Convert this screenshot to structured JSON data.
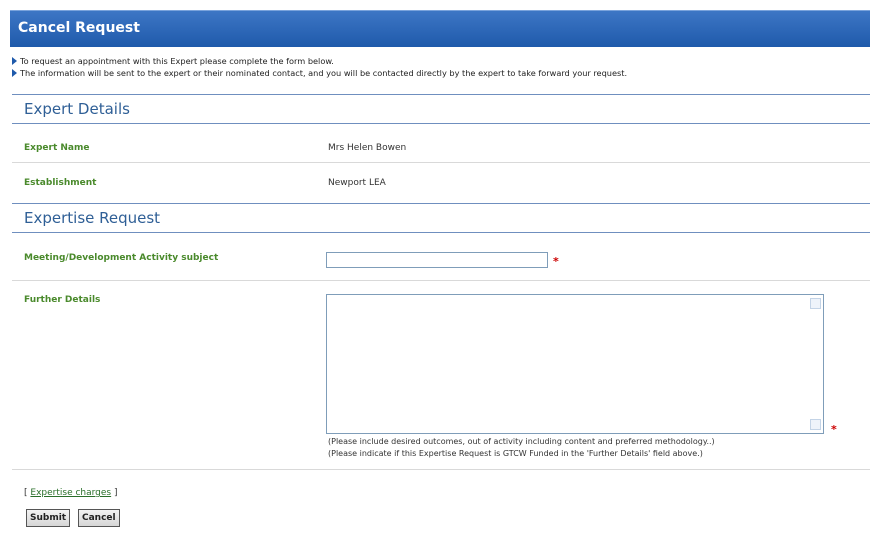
{
  "header": {
    "title": "Cancel Request"
  },
  "intro": {
    "lines": [
      "To request an appointment with this Expert please complete the form below.",
      "The information will be sent to the expert or their nominated contact, and you will be contacted directly by the expert to take forward your request."
    ]
  },
  "expert_details": {
    "heading": "Expert Details",
    "rows": [
      {
        "label": "Expert Name",
        "value": "Mrs Helen Bowen"
      },
      {
        "label": "Establishment",
        "value": "Newport LEA"
      }
    ]
  },
  "expertise_request": {
    "heading": "Expertise Request",
    "subject": {
      "label": "Meeting/Development Activity subject",
      "value": "",
      "required_mark": "*"
    },
    "details": {
      "label": "Further Details",
      "value": "",
      "required_mark": "*",
      "notes": [
        "(Please include desired outcomes, out of activity including content and preferred methodology..)",
        "(Please indicate if this Expertise Request is GTCW Funded in the 'Further Details' field above.)"
      ]
    }
  },
  "links": {
    "open": "[",
    "expertise_charges": "Expertise charges",
    "close": "]"
  },
  "buttons": {
    "submit": "Submit",
    "cancel": "Cancel"
  }
}
